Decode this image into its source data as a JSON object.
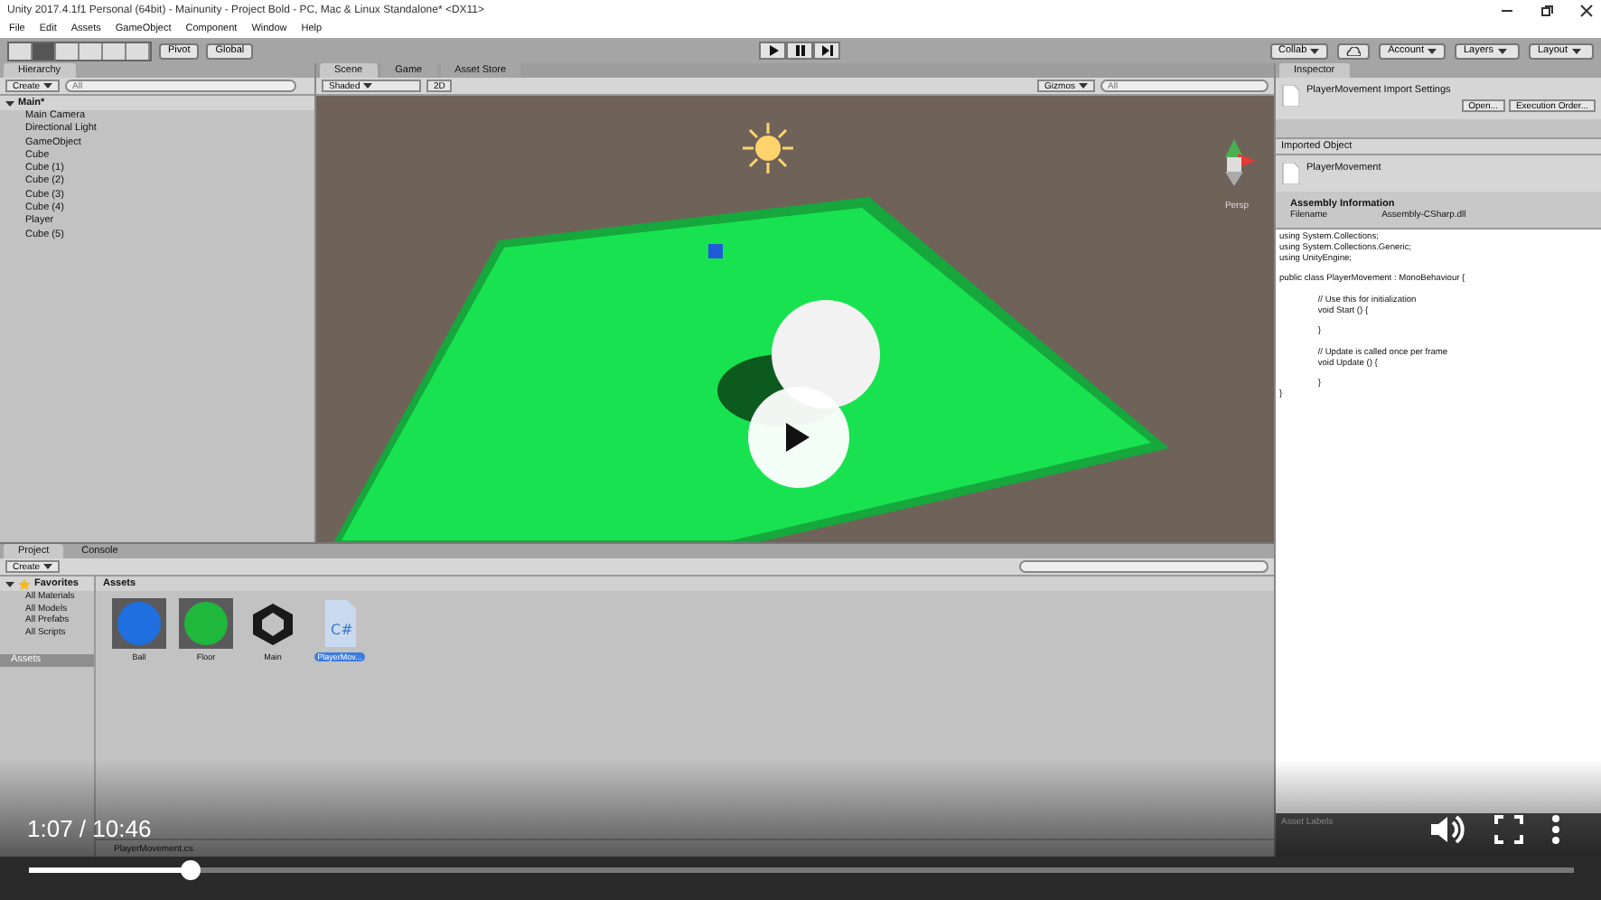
{
  "window": {
    "title": "Unity 2017.4.1f1 Personal (64bit) - Mainunity - Project Bold - PC, Mac & Linux Standalone* <DX11>"
  },
  "menu": [
    "File",
    "Edit",
    "Assets",
    "GameObject",
    "Component",
    "Window",
    "Help"
  ],
  "toolbar": {
    "pivot": "Pivot",
    "global": "Global",
    "collab": "Collab",
    "account": "Account",
    "layers": "Layers",
    "layout": "Layout"
  },
  "hierarchy": {
    "tab": "Hierarchy",
    "create": "Create",
    "search_placeholder": "All",
    "tree": [
      {
        "label": "Main*",
        "expanded": true,
        "children": [
          {
            "label": "Main Camera"
          },
          {
            "label": "Directional Light"
          },
          {
            "label": "GameObject"
          },
          {
            "label": "Cube"
          },
          {
            "label": "Cube (1)"
          },
          {
            "label": "Cube (2)"
          },
          {
            "label": "Cube (3)"
          },
          {
            "label": "Cube (4)"
          },
          {
            "label": "Player"
          },
          {
            "label": "Cube (5)"
          }
        ]
      }
    ]
  },
  "scene": {
    "tabs": [
      {
        "label": "Scene",
        "selected": true
      },
      {
        "label": "Game",
        "selected": false
      },
      {
        "label": "Asset Store",
        "selected": false
      }
    ],
    "shading": "Shaded",
    "mode_2d": "2D",
    "gizmos": "Gizmos",
    "search_placeholder": "All",
    "persp": "Persp"
  },
  "inspector": {
    "tab": "Inspector",
    "header": "PlayerMovement Import Settings",
    "buttons": [
      "Open...",
      "Execution Order..."
    ],
    "section": "Imported Object",
    "asset": "PlayerMovement",
    "assembly_title": "Assembly Information",
    "filename_label": "Filename",
    "filename_value": "Assembly-CSharp.dll",
    "code": "using System.Collections;\nusing System.Collections.Generic;\nusing UnityEngine;\n\npublic class PlayerMovement : MonoBehaviour {\n\n\t\t// Use this for initialization\n\t\tvoid Start () {\n\n\t\t}\n\n\t\t// Update is called once per frame\n\t\tvoid Update () {\n\n\t\t}\n}",
    "labels": "Asset Labels"
  },
  "project": {
    "tabs": [
      {
        "label": "Project",
        "selected": true
      },
      {
        "label": "Console",
        "selected": false
      }
    ],
    "create": "Create",
    "favorites": {
      "label": "Favorites",
      "expanded": true,
      "children": [
        {
          "label": "All Materials"
        },
        {
          "label": "All Models"
        },
        {
          "label": "All Prefabs"
        },
        {
          "label": "All Scripts"
        }
      ]
    },
    "folders": [
      {
        "label": "Assets",
        "selected": true
      }
    ],
    "breadcrumb": "Assets",
    "assets": [
      {
        "name": "Ball",
        "kind": "material",
        "color": "#1f6fe0",
        "selected": false
      },
      {
        "name": "Floor",
        "kind": "material",
        "color": "#1fb83c",
        "selected": false
      },
      {
        "name": "Main",
        "kind": "scene",
        "selected": false
      },
      {
        "name": "PlayerMov...",
        "kind": "script",
        "icon_label": "C#",
        "selected": true
      }
    ],
    "status": "PlayerMovement.cs"
  },
  "video": {
    "time": "1:07 / 10:46",
    "level": 0.104,
    "paused": true
  }
}
